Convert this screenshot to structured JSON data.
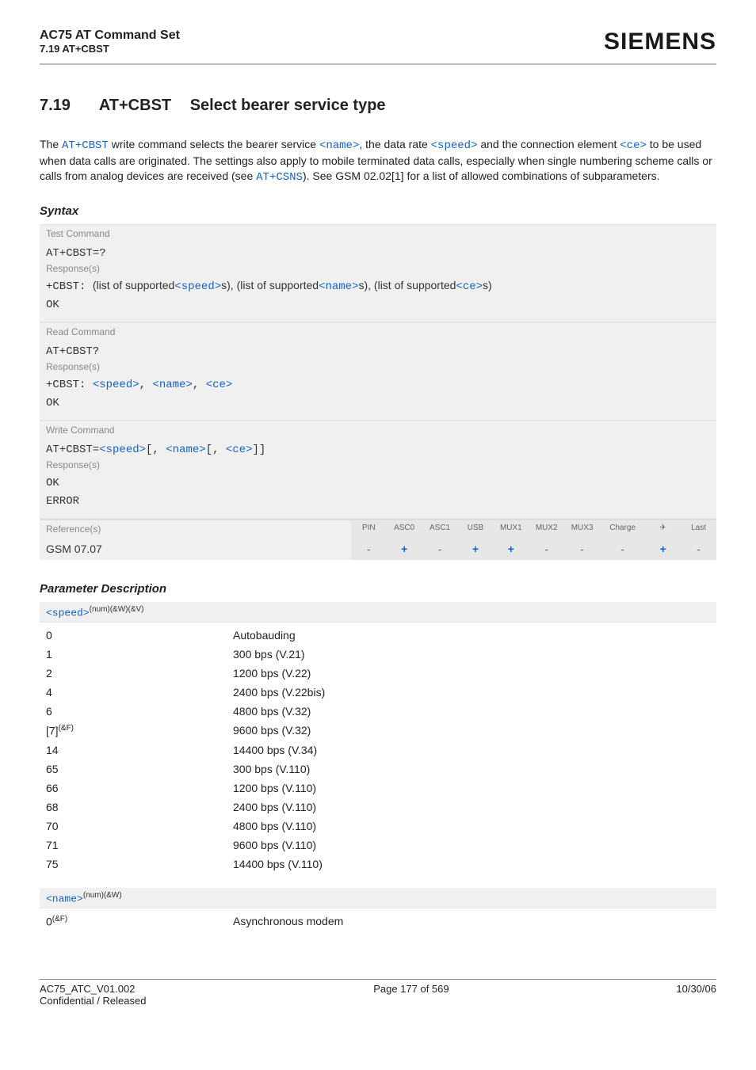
{
  "header": {
    "title1": "AC75 AT Command Set",
    "title2": "7.19 AT+CBST",
    "brand": "SIEMENS"
  },
  "section": {
    "number": "7.19",
    "code": "AT+CBST",
    "title": "Select bearer service type"
  },
  "intro": {
    "p1a": "The ",
    "link1": "AT+CBST",
    "p1b": " write command selects the bearer service ",
    "link2": "<name>",
    "p1c": ", the data rate ",
    "link3": "<speed>",
    "p1d": " and the connection element ",
    "link4": "<ce>",
    "p1e": " to be used when data calls are originated. The settings also apply to mobile terminated data calls, especially when single numbering scheme calls or calls from analog devices are received (see ",
    "link5": "AT+CSNS",
    "p1f": "). See GSM 02.02[1] for a list of allowed combinations of subparameters."
  },
  "syntax": {
    "heading": "Syntax",
    "test_label": "Test Command",
    "test_cmd": "AT+CBST=?",
    "response_label": "Response(s)",
    "test_resp_prefix": "+CBST: ",
    "test_resp_text1": "(list of supported",
    "test_resp_p1": "<speed>",
    "test_resp_text2": "s), (list of supported",
    "test_resp_p2": "<name>",
    "test_resp_text3": "s), (list of supported",
    "test_resp_p3": "<ce>",
    "test_resp_text4": "s)",
    "ok": "OK",
    "read_label": "Read Command",
    "read_cmd": "AT+CBST?",
    "read_resp_prefix": "+CBST: ",
    "read_resp_p1": "<speed>",
    "read_resp_sep": ", ",
    "read_resp_p2": "<name>",
    "read_resp_p3": "<ce>",
    "write_label": "Write Command",
    "write_cmd_prefix": "AT+CBST=",
    "write_p1": "<speed>",
    "write_b1": "[, ",
    "write_p2": "<name>",
    "write_b2": "[, ",
    "write_p3": "<ce>",
    "write_b3": "]]",
    "error": "ERROR",
    "ref_label": "Reference(s)",
    "ref_value": "GSM 07.07",
    "cols": [
      "PIN",
      "ASC0",
      "ASC1",
      "USB",
      "MUX1",
      "MUX2",
      "MUX3",
      "Charge",
      "✈",
      "Last"
    ],
    "vals": [
      "-",
      "+",
      "-",
      "+",
      "+",
      "-",
      "-",
      "-",
      "+",
      "-"
    ]
  },
  "params": {
    "heading": "Parameter Description",
    "speed_name": "<speed>",
    "speed_sup": "(num)(&W)(&V)",
    "speed_rows": [
      {
        "v": "0",
        "d": "Autobauding"
      },
      {
        "v": "1",
        "d": "300 bps (V.21)"
      },
      {
        "v": "2",
        "d": "1200 bps (V.22)"
      },
      {
        "v": "4",
        "d": "2400 bps (V.22bis)"
      },
      {
        "v": "6",
        "d": "4800 bps (V.32)"
      },
      {
        "v": "[7]",
        "sup": "(&F)",
        "d": "9600 bps (V.32)"
      },
      {
        "v": "14",
        "d": "14400 bps (V.34)"
      },
      {
        "v": "65",
        "d": "300 bps (V.110)"
      },
      {
        "v": "66",
        "d": "1200 bps (V.110)"
      },
      {
        "v": "68",
        "d": "2400 bps (V.110)"
      },
      {
        "v": "70",
        "d": "4800 bps (V.110)"
      },
      {
        "v": "71",
        "d": "9600 bps (V.110)"
      },
      {
        "v": "75",
        "d": "14400 bps (V.110)"
      }
    ],
    "name_name": "<name>",
    "name_sup": "(num)(&W)",
    "name_rows": [
      {
        "v": "0",
        "sup": "(&F)",
        "d": "Asynchronous modem"
      }
    ]
  },
  "footer": {
    "left1": "AC75_ATC_V01.002",
    "left2": "Confidential / Released",
    "center": "Page 177 of 569",
    "right": "10/30/06"
  }
}
